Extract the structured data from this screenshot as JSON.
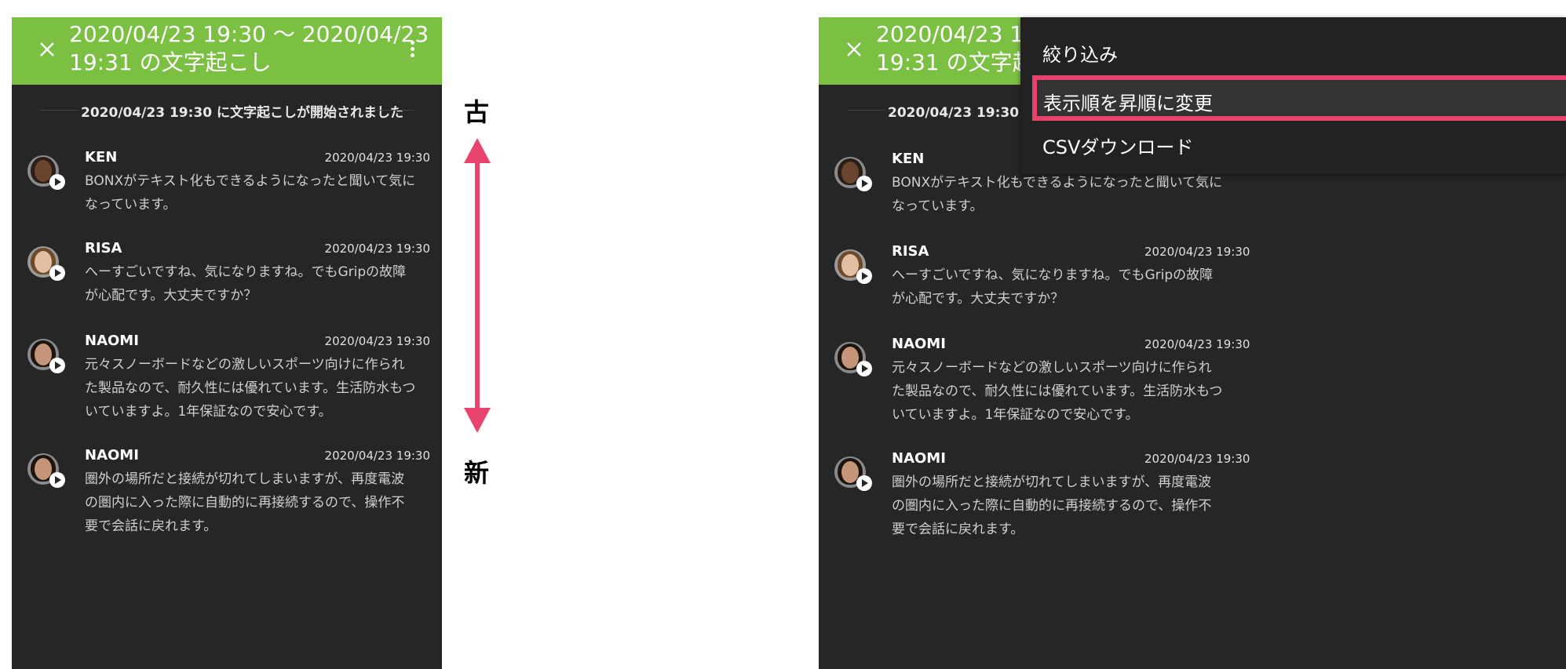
{
  "colors": {
    "accent": "#7cc043",
    "highlight": "#e8436d",
    "background": "#262626",
    "menu": "#222222",
    "arrow": "#e8436d"
  },
  "app": {
    "title_line1": "2020/04/23 19:30 〜 2020/04/23",
    "title_line2": "19:31 の文字起こし",
    "title_line1_truncated": "2020/04/23 19:30",
    "title_line2_truncated": "19:31 の文字起こ",
    "close_icon": "close-icon",
    "more_icon": "more-vert-icon"
  },
  "notice": {
    "text": "2020/04/23 19:30 に文字起こしが開始されました",
    "text_truncated": "2020/04/23 19:30 に文"
  },
  "messages": [
    {
      "name": "KEN",
      "time": "2020/04/23 19:30",
      "lines": [
        "BONXがテキスト化もできるようになったと聞いて気に",
        "なっています。"
      ]
    },
    {
      "name": "RISA",
      "time": "2020/04/23 19:30",
      "lines": [
        "へーすごいですね、気になりますね。でもGripの故障",
        "が心配です。大丈夫ですか？"
      ]
    },
    {
      "name": "NAOMI",
      "time": "2020/04/23 19:30",
      "lines": [
        "元々スノーボードなどの激しいスポーツ向けに作られ",
        "た製品なので、耐久性には優れています。生活防水もつ",
        "いていますよ。1年保証なので安心です。"
      ]
    },
    {
      "name": "NAOMI",
      "time": "2020/04/23 19:30",
      "lines": [
        "圏外の場所だと接続が切れてしまいますが、再度電波",
        "の圏内に入った際に自動的に再接続するので、操作不",
        "要で会話に戻れます。"
      ]
    }
  ],
  "right_messages": [
    {
      "name": "KEN",
      "time": "",
      "lines": [
        "BONXがテキスト化もできるようになったと聞いて気に",
        "なっています。"
      ]
    },
    {
      "name": "RISA",
      "time": "2020/04/23 19:30",
      "lines": [
        "へーすごいですね、気になりますね。でもGripの故障",
        "が心配です。大丈夫ですか？"
      ]
    },
    {
      "name": "NAOMI",
      "time": "2020/04/23 19:30",
      "lines": [
        "元々スノーボードなどの激しいスポーツ向けに作られ",
        "た製品なので、耐久性には優れています。生活防水もつ",
        "いていますよ。1年保証なので安心です。"
      ]
    },
    {
      "name": "NAOMI",
      "time": "2020/04/23 19:30",
      "lines": [
        "圏外の場所だと接続が切れてしまいますが、再度電波",
        "の圏内に入った際に自動的に再接続するので、操作不",
        "要で会話に戻れます。"
      ]
    }
  ],
  "menu": {
    "items": [
      "絞り込み",
      "表示順を昇順に変更",
      "CSVダウンロード"
    ],
    "highlighted_index": 1
  },
  "annotation": {
    "old": "古",
    "new": "新"
  }
}
